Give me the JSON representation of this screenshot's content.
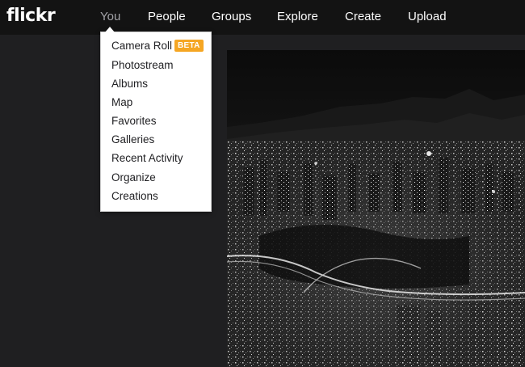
{
  "brand": {
    "logo_text": "flickr"
  },
  "nav": {
    "items": [
      {
        "label": "You",
        "active": true
      },
      {
        "label": "People"
      },
      {
        "label": "Groups"
      },
      {
        "label": "Explore"
      },
      {
        "label": "Create"
      },
      {
        "label": "Upload"
      }
    ]
  },
  "you_menu": {
    "items": [
      {
        "label": "Camera Roll",
        "badge": "BETA"
      },
      {
        "label": "Photostream"
      },
      {
        "label": "Albums"
      },
      {
        "label": "Map"
      },
      {
        "label": "Favorites"
      },
      {
        "label": "Galleries"
      },
      {
        "label": "Recent Activity"
      },
      {
        "label": "Organize"
      },
      {
        "label": "Creations"
      }
    ]
  },
  "colors": {
    "topbar_bg": "#131313",
    "page_bg": "#1f1f21",
    "nav_text": "#ffffff",
    "nav_active_text": "#a3a3a8",
    "beta_badge": "#f5a623"
  },
  "photo": {
    "description_icon": "city-night-photo"
  }
}
